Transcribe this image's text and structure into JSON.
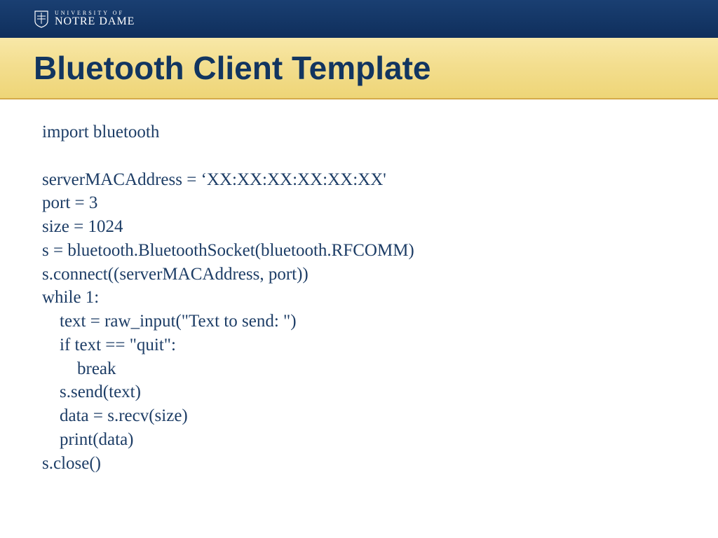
{
  "header": {
    "university_small": "UNIVERSITY OF",
    "university_big": "NOTRE DAME"
  },
  "title": "Bluetooth Client Template",
  "code": "import bluetooth\n\nserverMACAddress = ‘XX:XX:XX:XX:XX:XX'\nport = 3\nsize = 1024\ns = bluetooth.BluetoothSocket(bluetooth.RFCOMM)\ns.connect((serverMACAddress, port))\nwhile 1:\n    text = raw_input(\"Text to send: \")\n    if text == \"quit\":\n        break\n    s.send(text)\n    data = s.recv(size)\n    print(data)\ns.close()"
}
